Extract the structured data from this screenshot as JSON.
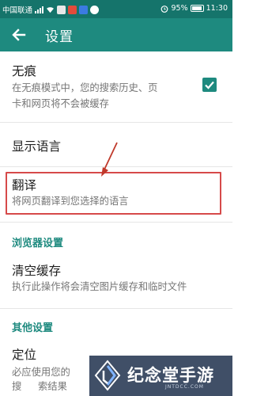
{
  "status_bar": {
    "carrier": "中国联通",
    "battery": "95%",
    "time": "11:30"
  },
  "app_bar": {
    "title": "设置",
    "back_icon": "arrow-left-icon"
  },
  "settings": {
    "incognito": {
      "title": "无痕",
      "summary_line1": "在无痕模式中，您的搜索历史、页",
      "summary_line2": "卡和网页将不会被缓存",
      "checked": true
    },
    "language": {
      "title": "显示语言"
    },
    "translate": {
      "title": "翻译",
      "summary": "将网页翻译到您选择的语言"
    },
    "browser_section": "浏览器设置",
    "clear_cache": {
      "title": "清空缓存",
      "summary": "执行此操作将会清空图片缓存和临时文件"
    },
    "other_section": "其他设置",
    "location": {
      "title": "定位",
      "summary_line1": "必应使用您的",
      "summary_line2": "索结果"
    }
  },
  "watermark": {
    "text": "纪念堂手游",
    "url": "JNTDCC.COM"
  },
  "colors": {
    "status_bar": "#15746b",
    "app_bar": "#1e8a7f",
    "accent": "#1e8a7f",
    "highlight_border": "#d64a4a",
    "arrow": "#c0392b"
  }
}
